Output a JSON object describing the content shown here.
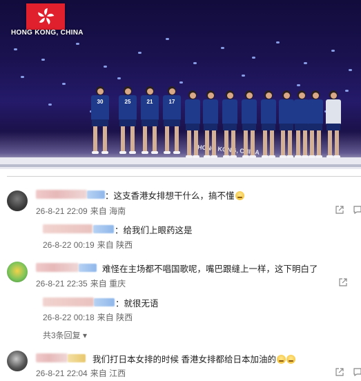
{
  "photo": {
    "flag_text": "HONG KONG, CHINA",
    "board_text": "HONG KONG, CHINA",
    "jersey_numbers": [
      "30",
      "25",
      "21",
      "17",
      "",
      "",
      "",
      "",
      "",
      "",
      "",
      "",
      ""
    ]
  },
  "comments": [
    {
      "text": "：这支香港女排想干什么，搞不懂",
      "date": "26-8-21 22:09",
      "source": "来自 海南",
      "replies": [
        {
          "text": "：给我们上眼药这是",
          "date": "26-8-22 00:19",
          "source": "来自 陕西"
        }
      ]
    },
    {
      "text": "难怪在主场都不唱国歌呢，嘴巴跟缝上一样，这下明白了",
      "date": "26-8-21 22:35",
      "source": "来自 重庆",
      "replies": [
        {
          "text": "：就很无语",
          "date": "26-8-22 00:18",
          "source": "来自 陕西"
        }
      ],
      "more_replies": "共3条回复",
      "more_arrow": "▾"
    },
    {
      "text": "我们打日本女排的时候  香港女排都给日本加油的",
      "date": "26-8-21 22:04",
      "source": "来自 江西"
    }
  ],
  "icons": {
    "share": "share-icon",
    "comment": "comment-icon"
  }
}
